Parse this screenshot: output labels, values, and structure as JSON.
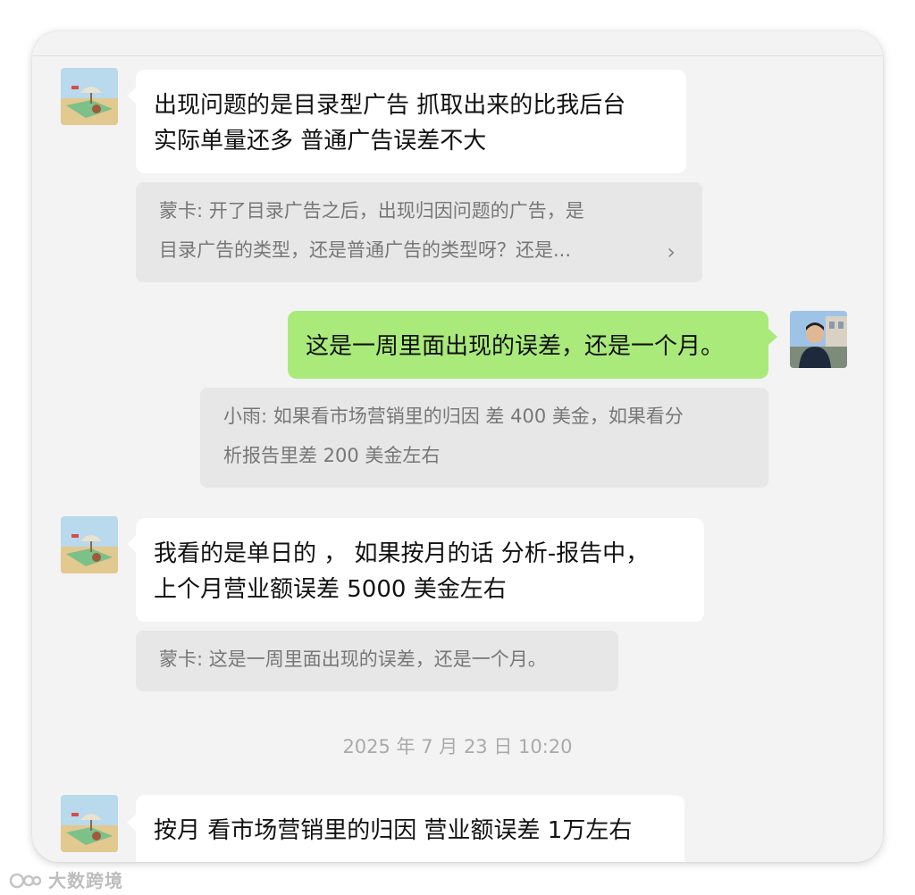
{
  "messages": [
    {
      "sender": "other",
      "lines": [
        "出现问题的是目录型广告 抓取出来的比我后台",
        "实际单量还多  普通广告误差不大"
      ],
      "quote": {
        "author": "蒙卡",
        "lines": [
          "蒙卡: 开了目录广告之后，出现归因问题的广告，是",
          "目录广告的类型，还是普通广告的类型呀？还是..."
        ]
      }
    },
    {
      "sender": "self",
      "lines": [
        "这是一周里面出现的误差，还是一个月。"
      ],
      "quote": {
        "author": "小雨",
        "lines": [
          "小雨: 如果看市场营销里的归因 差 400 美金，如果看分",
          "析报告里差 200 美金左右"
        ]
      }
    },
    {
      "sender": "other",
      "lines": [
        "我看的是单日的 ，  如果按月的话 分析-报告中，",
        "上个月营业额误差 5000 美金左右"
      ],
      "quote": {
        "author": "蒙卡",
        "lines": [
          "蒙卡: 这是一周里面出现的误差，还是一个月。"
        ]
      }
    },
    {
      "sender": "other",
      "lines": [
        "按月 看市场营销里的归因 营业额误差 1万左右"
      ]
    }
  ],
  "timestamp": "2025 年 7 月 23 日 10:20",
  "quote_more_icon": "chevron-right-icon",
  "watermark": "大数跨境",
  "colors": {
    "background": "#f3f3f3",
    "incoming_bubble": "#ffffff",
    "outgoing_bubble": "#a9ea7a",
    "quote_bg": "#e7e7e7",
    "quote_text": "#777777",
    "timestamp_text": "#aaaaaa"
  }
}
